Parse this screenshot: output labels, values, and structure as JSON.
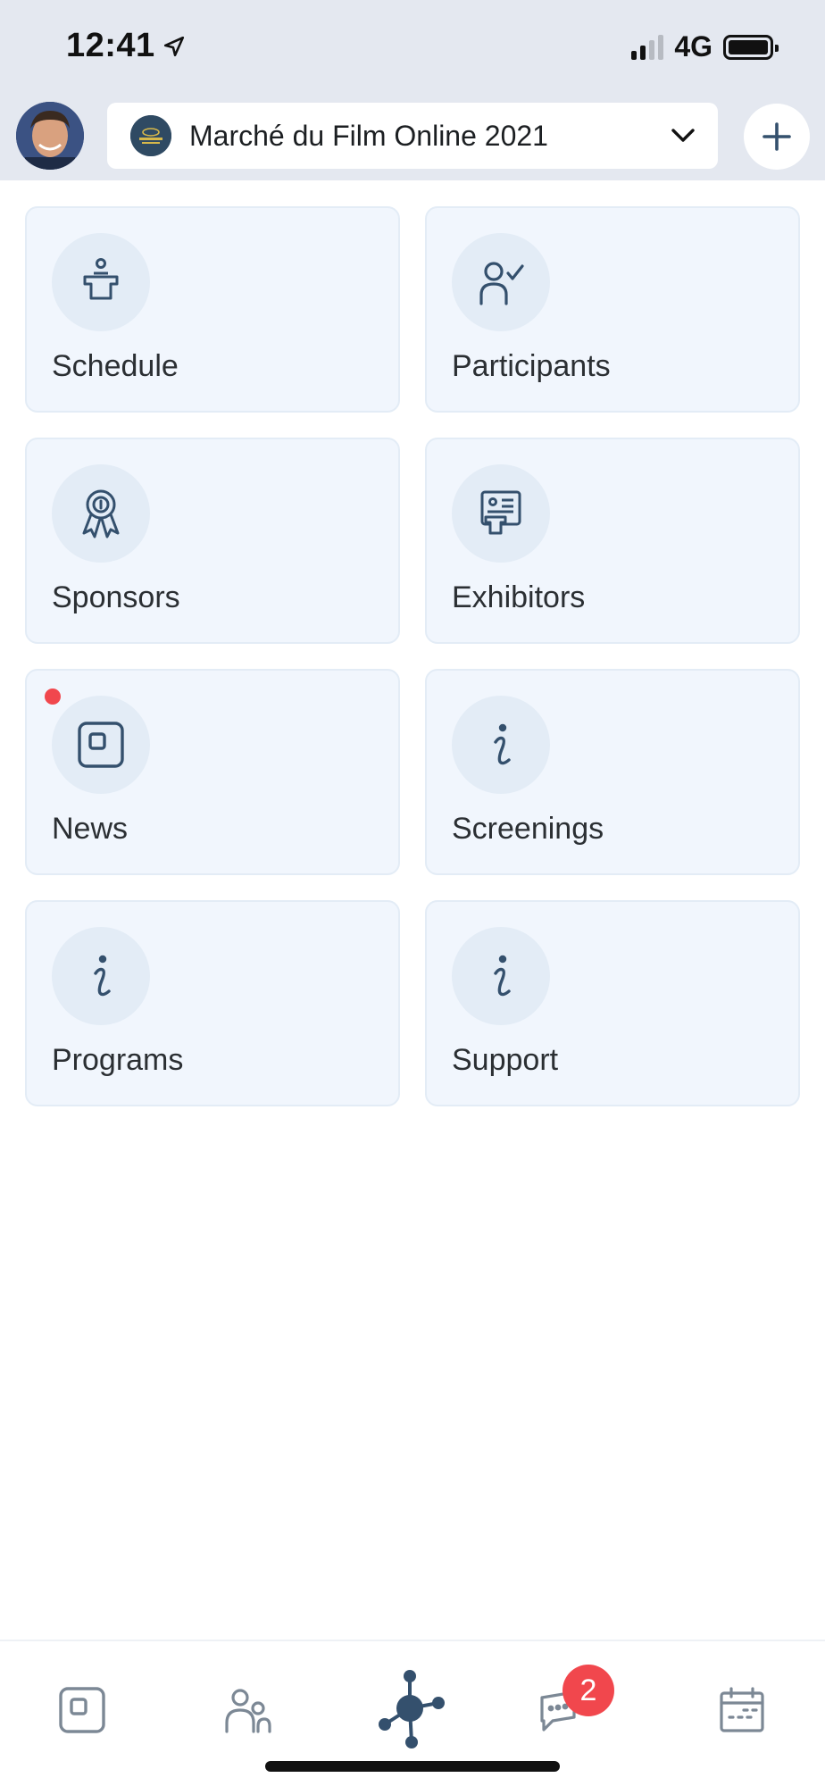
{
  "status_bar": {
    "time": "12:41",
    "network": "4G"
  },
  "header": {
    "event_name": "Marché du Film Online 2021"
  },
  "tiles": [
    {
      "label": "Schedule",
      "icon": "podium-icon"
    },
    {
      "label": "Participants",
      "icon": "person-check-icon"
    },
    {
      "label": "Sponsors",
      "icon": "award-ribbon-icon"
    },
    {
      "label": "Exhibitors",
      "icon": "exhibitor-booth-icon"
    },
    {
      "label": "News",
      "icon": "news-square-icon",
      "has_notification": true
    },
    {
      "label": "Screenings",
      "icon": "info-icon"
    },
    {
      "label": "Programs",
      "icon": "info-icon"
    },
    {
      "label": "Support",
      "icon": "info-icon"
    }
  ],
  "tabbar": {
    "items": [
      "news-square-icon",
      "people-icon",
      "hub-network-icon",
      "chat-icon",
      "calendar-icon"
    ],
    "chat_badge": "2",
    "active": "hub-network-icon"
  },
  "colors": {
    "accent": "#34506d",
    "inactive": "#7c8895",
    "badge": "#f1474d",
    "tile_bg": "#f1f6fd"
  }
}
